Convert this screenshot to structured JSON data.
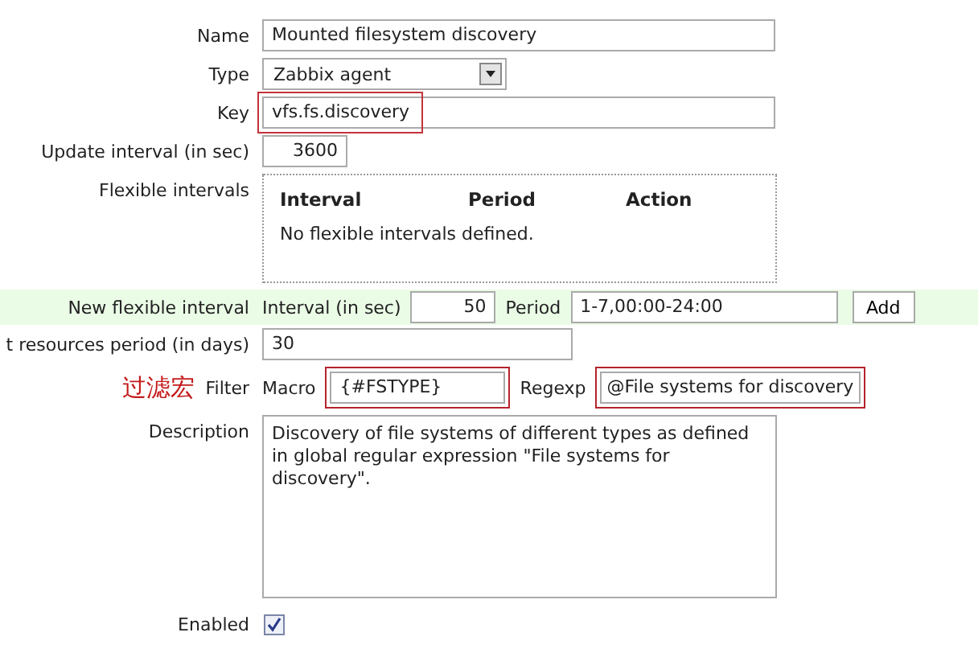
{
  "name": {
    "label": "Name",
    "value": "Mounted filesystem discovery"
  },
  "type": {
    "label": "Type",
    "value": "Zabbix agent"
  },
  "key": {
    "label": "Key",
    "value": "vfs.fs.discovery",
    "highlighted": true
  },
  "update_interval": {
    "label": "Update interval (in sec)",
    "value": "3600"
  },
  "flexible_intervals": {
    "label": "Flexible intervals",
    "columns": [
      "Interval",
      "Period",
      "Action"
    ],
    "empty_text": "No flexible intervals defined."
  },
  "new_flexible_interval": {
    "label": "New flexible interval",
    "interval_label": "Interval (in sec)",
    "interval_value": "50",
    "period_label": "Period",
    "period_value": "1-7,00:00-24:00",
    "button": "Add"
  },
  "resources_period": {
    "label": "t resources period (in days)",
    "value": "30"
  },
  "filter": {
    "annotation": "过滤宏",
    "label": "Filter",
    "macro_label": "Macro",
    "macro_value": "{#FSTYPE}",
    "macro_highlighted": true,
    "regexp_label": "Regexp",
    "regexp_value": "@File systems for discovery",
    "regexp_highlighted": true
  },
  "description": {
    "label": "Description",
    "value": "Discovery of file systems of different types as defined in global regular expression \"File systems for discovery\"."
  },
  "enabled": {
    "label": "Enabled",
    "checked": true
  }
}
